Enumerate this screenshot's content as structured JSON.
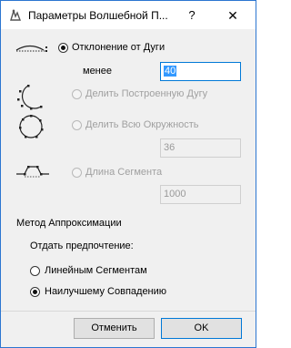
{
  "window": {
    "title": "Параметры Волшебной П...",
    "help_label": "?",
    "close_label": "✕"
  },
  "options": {
    "arc_deviation": {
      "label": "Отклонение от Дуги",
      "less_label": "менее",
      "value": "40"
    },
    "divide_built_arc": {
      "label": "Делить Построенную Дугу"
    },
    "divide_full_circle": {
      "label": "Делить Всю Окружность",
      "value": "36"
    },
    "segment_length": {
      "label": "Длина Сегмента",
      "value": "1000"
    }
  },
  "approximation": {
    "heading": "Метод Аппроксимации",
    "preference_label": "Отдать предпочтение:",
    "linear_segments": "Линейным Сегментам",
    "best_fit": "Наилучшему Совпадению"
  },
  "buttons": {
    "cancel": "Отменить",
    "ok": "OK"
  },
  "icons": [
    "app-icon",
    "arc-deviation-icon",
    "arc-divide-icon",
    "circle-divide-icon",
    "segment-length-icon"
  ],
  "colors": {
    "accent": "#0078d7",
    "selection": "#3399ff",
    "disabled_text": "#a0a0a0"
  }
}
